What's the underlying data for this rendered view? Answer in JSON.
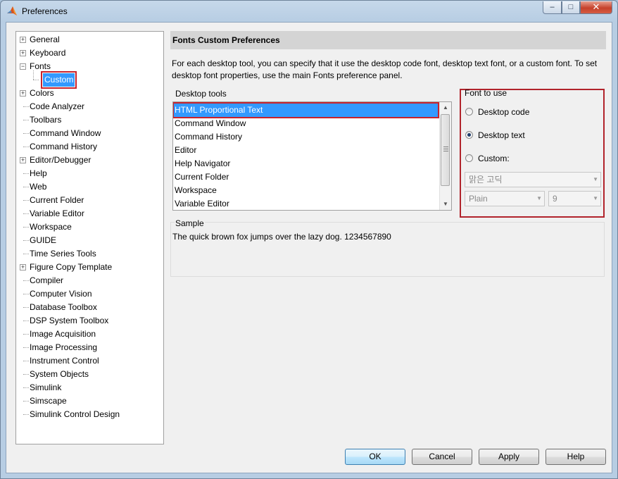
{
  "window": {
    "title": "Preferences"
  },
  "tree": {
    "items": [
      {
        "label": "General",
        "expander": "+"
      },
      {
        "label": "Keyboard",
        "expander": "+"
      },
      {
        "label": "Fonts",
        "expander": "-"
      },
      {
        "label": "Custom",
        "expander": ""
      },
      {
        "label": "Colors",
        "expander": "+"
      },
      {
        "label": "Code Analyzer",
        "expander": ""
      },
      {
        "label": "Toolbars",
        "expander": ""
      },
      {
        "label": "Command Window",
        "expander": ""
      },
      {
        "label": "Command History",
        "expander": ""
      },
      {
        "label": "Editor/Debugger",
        "expander": "+"
      },
      {
        "label": "Help",
        "expander": ""
      },
      {
        "label": "Web",
        "expander": ""
      },
      {
        "label": "Current Folder",
        "expander": ""
      },
      {
        "label": "Variable Editor",
        "expander": ""
      },
      {
        "label": "Workspace",
        "expander": ""
      },
      {
        "label": "GUIDE",
        "expander": ""
      },
      {
        "label": "Time Series Tools",
        "expander": ""
      },
      {
        "label": "Figure Copy Template",
        "expander": "+"
      },
      {
        "label": "Compiler",
        "expander": ""
      },
      {
        "label": "Computer Vision",
        "expander": ""
      },
      {
        "label": "Database Toolbox",
        "expander": ""
      },
      {
        "label": "DSP System Toolbox",
        "expander": ""
      },
      {
        "label": "Image Acquisition",
        "expander": ""
      },
      {
        "label": "Image Processing",
        "expander": ""
      },
      {
        "label": "Instrument Control",
        "expander": ""
      },
      {
        "label": "System Objects",
        "expander": ""
      },
      {
        "label": "Simulink",
        "expander": ""
      },
      {
        "label": "Simscape",
        "expander": ""
      },
      {
        "label": "Simulink Control Design",
        "expander": ""
      }
    ],
    "selected": "Custom"
  },
  "panel": {
    "header": "Fonts Custom Preferences",
    "description": "For each desktop tool, you can specify that it use the desktop code font, desktop text font, or a custom font.  To set desktop font properties, use the main Fonts preference panel."
  },
  "desktop_tools": {
    "label": "Desktop tools",
    "items": [
      "HTML Proportional Text",
      "Command Window",
      "Command History",
      "Editor",
      "Help Navigator",
      "Current Folder",
      "Workspace",
      "Variable Editor"
    ],
    "selected": "HTML Proportional Text"
  },
  "font_to_use": {
    "label": "Font to use",
    "options": [
      "Desktop code",
      "Desktop text",
      "Custom:"
    ],
    "selected": "Desktop text",
    "font_name": "맑은 고딕",
    "font_style": "Plain",
    "font_size": "9"
  },
  "sample": {
    "label": "Sample",
    "text": "The quick brown fox jumps over the lazy dog.  1234567890"
  },
  "buttons": {
    "ok": "OK",
    "cancel": "Cancel",
    "apply": "Apply",
    "help": "Help"
  },
  "colors": {
    "selection": "#3399ff",
    "highlight_border": "#b1232b"
  }
}
